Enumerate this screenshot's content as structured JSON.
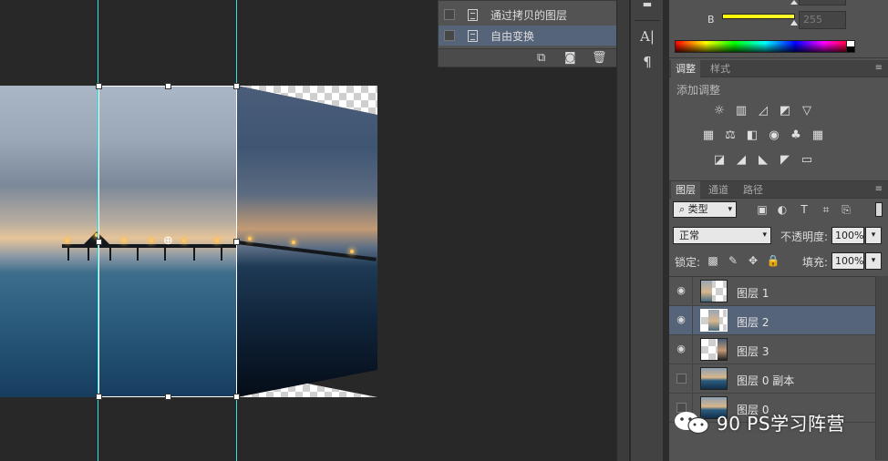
{
  "history": {
    "items": [
      {
        "label": "通过拷贝的图层",
        "selected": false
      },
      {
        "label": "自由变换",
        "selected": true
      }
    ]
  },
  "color": {
    "b_label": "B",
    "b_value": "255",
    "b_value_previous": "255"
  },
  "adjust": {
    "tabs": [
      "调整",
      "样式"
    ],
    "title": "添加调整"
  },
  "layers": {
    "tabs": [
      "图层",
      "通道",
      "路径"
    ],
    "filter": "类型",
    "blend_mode": "正常",
    "opacity_label": "不透明度:",
    "opacity_value": "100%",
    "lock_label": "锁定:",
    "fill_label": "填充:",
    "fill_value": "100%",
    "items": [
      {
        "name": "图层 1",
        "visible": true,
        "selected": false
      },
      {
        "name": "图层 2",
        "visible": true,
        "selected": true
      },
      {
        "name": "图层 3",
        "visible": true,
        "selected": false
      },
      {
        "name": "图层 0 副本",
        "visible": false,
        "selected": false
      },
      {
        "name": "图层 0",
        "visible": false,
        "selected": false
      }
    ]
  },
  "watermark": {
    "text": "90 PS学习阵营"
  },
  "colors": {
    "guide": "#2ee2e2",
    "seam": "#c0262a",
    "selection": "#56647a",
    "panel": "#535353",
    "canvas_bg": "#282828"
  }
}
